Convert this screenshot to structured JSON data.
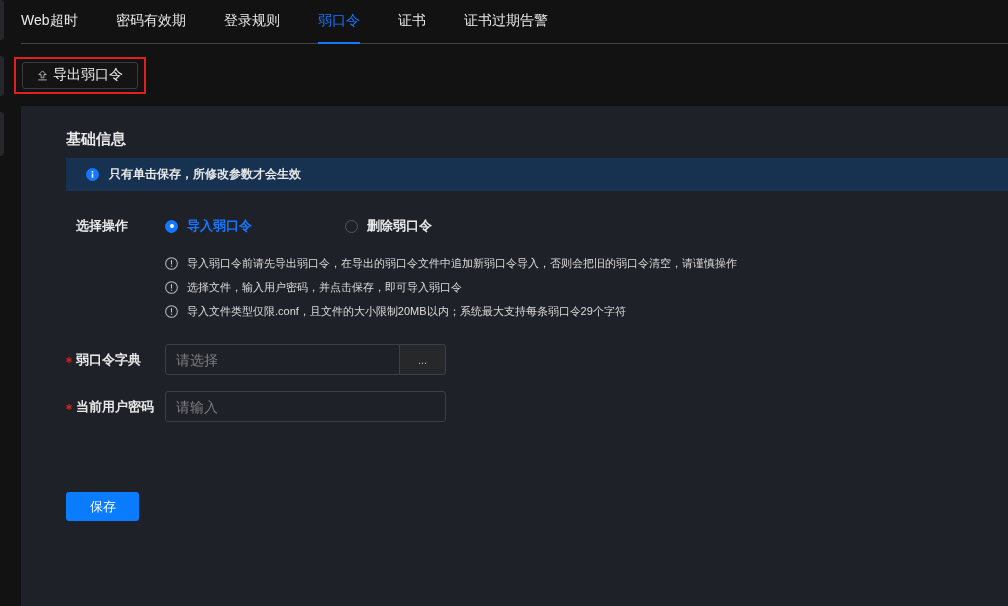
{
  "tabs": [
    {
      "label": "Web超时",
      "selected": false
    },
    {
      "label": "密码有效期",
      "selected": false
    },
    {
      "label": "登录规则",
      "selected": false
    },
    {
      "label": "弱口令",
      "selected": true
    },
    {
      "label": "证书",
      "selected": false
    },
    {
      "label": "证书过期告警",
      "selected": false
    }
  ],
  "export_button": {
    "label": "导出弱口令",
    "highlighted": true
  },
  "panel": {
    "title": "基础信息",
    "alert": {
      "text": "只有单击保存，所修改参数才会生效"
    },
    "operation": {
      "label": "选择操作",
      "options": [
        {
          "label": "导入弱口令",
          "selected": true
        },
        {
          "label": "删除弱口令",
          "selected": false
        }
      ]
    },
    "notes": [
      "导入弱口令前请先导出弱口令，在导出的弱口令文件中追加新弱口令导入，否则会把旧的弱口令清空，请谨慎操作",
      "选择文件，输入用户密码，并点击保存，即可导入弱口令",
      "导入文件类型仅限.conf，且文件的大小限制20MB以内；系统最大支持每条弱口令29个字符"
    ],
    "fields": [
      {
        "label": "弱口令字典",
        "required": true,
        "kind": "file",
        "placeholder": "请选择",
        "browse": "..."
      },
      {
        "label": "当前用户密码",
        "required": true,
        "kind": "text",
        "placeholder": "请输入"
      }
    ],
    "save_button": "保存"
  }
}
